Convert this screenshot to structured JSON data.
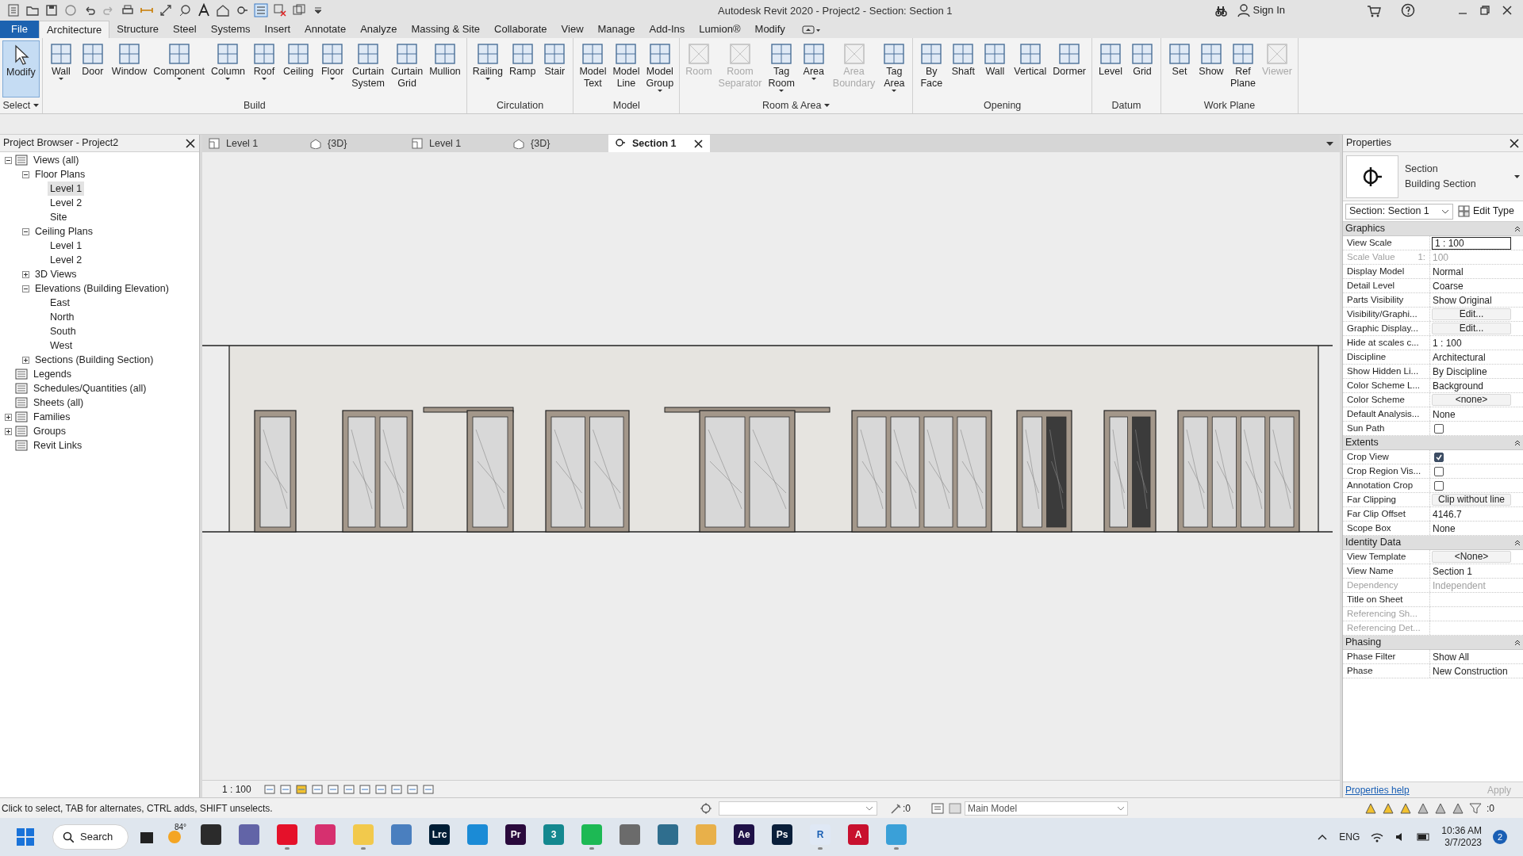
{
  "window": {
    "title": "Autodesk Revit 2020 - Project2 - Section: Section 1",
    "sign_in": "Sign In"
  },
  "ribbon": {
    "file_button": "File",
    "tabs": [
      {
        "label": "Architecture",
        "selected": true
      },
      {
        "label": "Structure",
        "selected": false
      },
      {
        "label": "Steel",
        "selected": false
      },
      {
        "label": "Systems",
        "selected": false
      },
      {
        "label": "Insert",
        "selected": false
      },
      {
        "label": "Annotate",
        "selected": false
      },
      {
        "label": "Analyze",
        "selected": false
      },
      {
        "label": "Massing & Site",
        "selected": false
      },
      {
        "label": "Collaborate",
        "selected": false
      },
      {
        "label": "View",
        "selected": false
      },
      {
        "label": "Manage",
        "selected": false
      },
      {
        "label": "Add-Ins",
        "selected": false
      },
      {
        "label": "Lumion®",
        "selected": false
      },
      {
        "label": "Modify",
        "selected": false
      }
    ],
    "panels": [
      {
        "title": "Select",
        "has_menu": true,
        "tools": [
          {
            "label": "Modify",
            "selected": true,
            "disabled": false,
            "has_dropdown": false
          }
        ]
      },
      {
        "title": "Build",
        "has_menu": false,
        "tools": [
          {
            "label": "Wall",
            "selected": false,
            "disabled": false,
            "has_dropdown": true
          },
          {
            "label": "Door",
            "selected": false,
            "disabled": false,
            "has_dropdown": false
          },
          {
            "label": "Window",
            "selected": false,
            "disabled": false,
            "has_dropdown": false
          },
          {
            "label": "Component",
            "selected": false,
            "disabled": false,
            "has_dropdown": true
          },
          {
            "label": "Column",
            "selected": false,
            "disabled": false,
            "has_dropdown": true
          },
          {
            "label": "Roof",
            "selected": false,
            "disabled": false,
            "has_dropdown": true
          },
          {
            "label": "Ceiling",
            "selected": false,
            "disabled": false,
            "has_dropdown": false
          },
          {
            "label": "Floor",
            "selected": false,
            "disabled": false,
            "has_dropdown": true
          },
          {
            "label": "Curtain\nSystem",
            "selected": false,
            "disabled": false,
            "has_dropdown": false
          },
          {
            "label": "Curtain\nGrid",
            "selected": false,
            "disabled": false,
            "has_dropdown": false
          },
          {
            "label": "Mullion",
            "selected": false,
            "disabled": false,
            "has_dropdown": false
          }
        ]
      },
      {
        "title": "Circulation",
        "has_menu": false,
        "tools": [
          {
            "label": "Railing",
            "selected": false,
            "disabled": false,
            "has_dropdown": true
          },
          {
            "label": "Ramp",
            "selected": false,
            "disabled": false,
            "has_dropdown": false
          },
          {
            "label": "Stair",
            "selected": false,
            "disabled": false,
            "has_dropdown": false
          }
        ]
      },
      {
        "title": "Model",
        "has_menu": false,
        "tools": [
          {
            "label": "Model\nText",
            "selected": false,
            "disabled": false,
            "has_dropdown": false
          },
          {
            "label": "Model\nLine",
            "selected": false,
            "disabled": false,
            "has_dropdown": false
          },
          {
            "label": "Model\nGroup",
            "selected": false,
            "disabled": false,
            "has_dropdown": true
          }
        ]
      },
      {
        "title": "Room & Area",
        "has_menu": true,
        "tools": [
          {
            "label": "Room",
            "selected": false,
            "disabled": true,
            "has_dropdown": false
          },
          {
            "label": "Room\nSeparator",
            "selected": false,
            "disabled": true,
            "has_dropdown": false
          },
          {
            "label": "Tag\nRoom",
            "selected": false,
            "disabled": false,
            "has_dropdown": true
          },
          {
            "label": "Area",
            "selected": false,
            "disabled": false,
            "has_dropdown": true
          },
          {
            "label": "Area\nBoundary",
            "selected": false,
            "disabled": true,
            "has_dropdown": false
          },
          {
            "label": "Tag\nArea",
            "selected": false,
            "disabled": false,
            "has_dropdown": true
          }
        ]
      },
      {
        "title": "Opening",
        "has_menu": false,
        "tools": [
          {
            "label": "By\nFace",
            "selected": false,
            "disabled": false,
            "has_dropdown": false
          },
          {
            "label": "Shaft",
            "selected": false,
            "disabled": false,
            "has_dropdown": false
          },
          {
            "label": "Wall",
            "selected": false,
            "disabled": false,
            "has_dropdown": false
          },
          {
            "label": "Vertical",
            "selected": false,
            "disabled": false,
            "has_dropdown": false
          },
          {
            "label": "Dormer",
            "selected": false,
            "disabled": false,
            "has_dropdown": false
          }
        ]
      },
      {
        "title": "Datum",
        "has_menu": false,
        "tools": [
          {
            "label": "Level",
            "selected": false,
            "disabled": false,
            "has_dropdown": false
          },
          {
            "label": "Grid",
            "selected": false,
            "disabled": false,
            "has_dropdown": false
          }
        ]
      },
      {
        "title": "Work Plane",
        "has_menu": false,
        "tools": [
          {
            "label": "Set",
            "selected": false,
            "disabled": false,
            "has_dropdown": false
          },
          {
            "label": "Show",
            "selected": false,
            "disabled": false,
            "has_dropdown": false
          },
          {
            "label": "Ref\nPlane",
            "selected": false,
            "disabled": false,
            "has_dropdown": false
          },
          {
            "label": "Viewer",
            "selected": false,
            "disabled": true,
            "has_dropdown": false
          }
        ]
      }
    ]
  },
  "project_browser": {
    "title": "Project Browser - Project2",
    "items": [
      {
        "label": "Views (all)",
        "expanded": true,
        "selected": false,
        "children": [
          {
            "label": "Floor Plans",
            "expanded": true,
            "selected": false,
            "children": [
              {
                "label": "Level 1",
                "selected": true
              },
              {
                "label": "Level 2",
                "selected": false
              },
              {
                "label": "Site",
                "selected": false
              }
            ]
          },
          {
            "label": "Ceiling Plans",
            "expanded": true,
            "selected": false,
            "children": [
              {
                "label": "Level 1",
                "selected": false
              },
              {
                "label": "Level 2",
                "selected": false
              }
            ]
          },
          {
            "label": "3D Views",
            "expanded": false,
            "selected": false
          },
          {
            "label": "Elevations (Building Elevation)",
            "expanded": true,
            "selected": false,
            "children": [
              {
                "label": "East",
                "selected": false
              },
              {
                "label": "North",
                "selected": false
              },
              {
                "label": "South",
                "selected": false
              },
              {
                "label": "West",
                "selected": false
              }
            ]
          },
          {
            "label": "Sections (Building Section)",
            "expanded": false,
            "selected": false
          }
        ]
      },
      {
        "label": "Legends",
        "selected": false
      },
      {
        "label": "Schedules/Quantities (all)",
        "selected": false
      },
      {
        "label": "Sheets (all)",
        "selected": false
      },
      {
        "label": "Families",
        "expanded": false,
        "selected": false
      },
      {
        "label": "Groups",
        "expanded": false,
        "selected": false
      },
      {
        "label": "Revit Links",
        "selected": false
      }
    ]
  },
  "view_tabs": [
    {
      "label": "Level 1",
      "kind": "plan",
      "selected": false
    },
    {
      "label": "{3D}",
      "kind": "model",
      "selected": false
    },
    {
      "label": "Level 1",
      "kind": "plan",
      "selected": false
    },
    {
      "label": "{3D}",
      "kind": "model",
      "selected": false
    },
    {
      "label": "Section 1",
      "kind": "section",
      "selected": true
    }
  ],
  "view_bar": {
    "scale": "1 : 100"
  },
  "properties": {
    "title": "Properties",
    "type_name": "Section",
    "type_family": "Building Section",
    "instance_selector": "Section: Section 1",
    "edit_type": "Edit Type",
    "groups": [
      {
        "title": "Graphics",
        "rows": [
          {
            "label": "View Scale",
            "kind": "field",
            "value": "1 : 100",
            "disabled": false
          },
          {
            "label": "Scale Value",
            "unit": "1:",
            "kind": "text",
            "value": "100",
            "disabled": true
          },
          {
            "label": "Display Model",
            "kind": "text",
            "value": "Normal",
            "disabled": false
          },
          {
            "label": "Detail Level",
            "kind": "text",
            "value": "Coarse",
            "disabled": false
          },
          {
            "label": "Parts Visibility",
            "kind": "text",
            "value": "Show Original",
            "disabled": false
          },
          {
            "label": "Visibility/Graphi...",
            "kind": "button",
            "value": "Edit...",
            "disabled": false
          },
          {
            "label": "Graphic Display...",
            "kind": "button",
            "value": "Edit...",
            "disabled": false
          },
          {
            "label": "Hide at scales c...",
            "kind": "text",
            "value": "1 : 100",
            "disabled": false
          },
          {
            "label": "Discipline",
            "kind": "text",
            "value": "Architectural",
            "disabled": false
          },
          {
            "label": "Show Hidden Li...",
            "kind": "text",
            "value": "By Discipline",
            "disabled": false
          },
          {
            "label": "Color Scheme L...",
            "kind": "text",
            "value": "Background",
            "disabled": false
          },
          {
            "label": "Color Scheme",
            "kind": "button",
            "value": "<none>",
            "disabled": false
          },
          {
            "label": "Default Analysis...",
            "kind": "text",
            "value": "None",
            "disabled": false
          },
          {
            "label": "Sun Path",
            "kind": "checkbox",
            "checked": false,
            "disabled": false
          }
        ]
      },
      {
        "title": "Extents",
        "rows": [
          {
            "label": "Crop View",
            "kind": "checkbox",
            "checked": true,
            "disabled": false
          },
          {
            "label": "Crop Region Vis...",
            "kind": "checkbox",
            "checked": false,
            "disabled": false
          },
          {
            "label": "Annotation Crop",
            "kind": "checkbox",
            "checked": false,
            "disabled": false
          },
          {
            "label": "Far Clipping",
            "kind": "button",
            "value": "Clip without line",
            "disabled": false
          },
          {
            "label": "Far Clip Offset",
            "kind": "text",
            "value": "4146.7",
            "disabled": false
          },
          {
            "label": "Scope Box",
            "kind": "text",
            "value": "None",
            "disabled": false
          }
        ]
      },
      {
        "title": "Identity Data",
        "rows": [
          {
            "label": "View Template",
            "kind": "button",
            "value": "<None>",
            "disabled": false
          },
          {
            "label": "View Name",
            "kind": "text",
            "value": "Section 1",
            "disabled": false
          },
          {
            "label": "Dependency",
            "kind": "text",
            "value": "Independent",
            "disabled": true
          },
          {
            "label": "Title on Sheet",
            "kind": "text",
            "disabled": false
          },
          {
            "label": "Referencing Sh...",
            "kind": "text",
            "disabled": true
          },
          {
            "label": "Referencing Det...",
            "kind": "text",
            "disabled": true
          }
        ]
      },
      {
        "title": "Phasing",
        "rows": [
          {
            "label": "Phase Filter",
            "kind": "text",
            "value": "Show All",
            "disabled": false
          },
          {
            "label": "Phase",
            "kind": "text",
            "value": "New Construction",
            "disabled": false
          }
        ]
      }
    ],
    "help_link": "Properties help",
    "apply_button": "Apply",
    "apply_disabled": true
  },
  "status_bar": {
    "message": "Click to select, TAB for alternates, CTRL adds, SHIFT unselects.",
    "selection_count": ":0",
    "workset": "Main Model",
    "filter_count": ":0"
  },
  "taskbar": {
    "search": "Search",
    "weather": "84°",
    "language": "ENG",
    "time": "10:36 AM",
    "date": "3/7/2023",
    "notifications": "2",
    "apps": [
      {
        "color": "#2b2b2b",
        "running": false
      },
      {
        "color": "#6264a7",
        "running": false
      },
      {
        "color": "#e5112a",
        "running": true
      },
      {
        "color": "#d6306f",
        "running": false
      },
      {
        "color": "#f2c94c",
        "running": true
      },
      {
        "color": "#4a7fbf",
        "running": false
      },
      {
        "label": "Lrc",
        "color": "#001e36",
        "running": false
      },
      {
        "color": "#1b8bd6",
        "running": false
      },
      {
        "label": "Pr",
        "color": "#2a0a3c",
        "running": false
      },
      {
        "label": "3",
        "color": "#14888f",
        "running": false
      },
      {
        "color": "#1db954",
        "running": true
      },
      {
        "color": "#6b6b6b",
        "running": false
      },
      {
        "color": "#2f6e8e",
        "running": false
      },
      {
        "color": "#e8b04a",
        "running": false
      },
      {
        "label": "Ae",
        "color": "#1f1147",
        "running": false
      },
      {
        "label": "Ps",
        "color": "#0a1f3a",
        "running": false
      },
      {
        "label": "R",
        "color": "#dfe8f5",
        "running": true
      },
      {
        "label": "A",
        "color": "#c8102e",
        "running": false
      },
      {
        "color": "#3aa0d8",
        "running": true
      }
    ]
  }
}
